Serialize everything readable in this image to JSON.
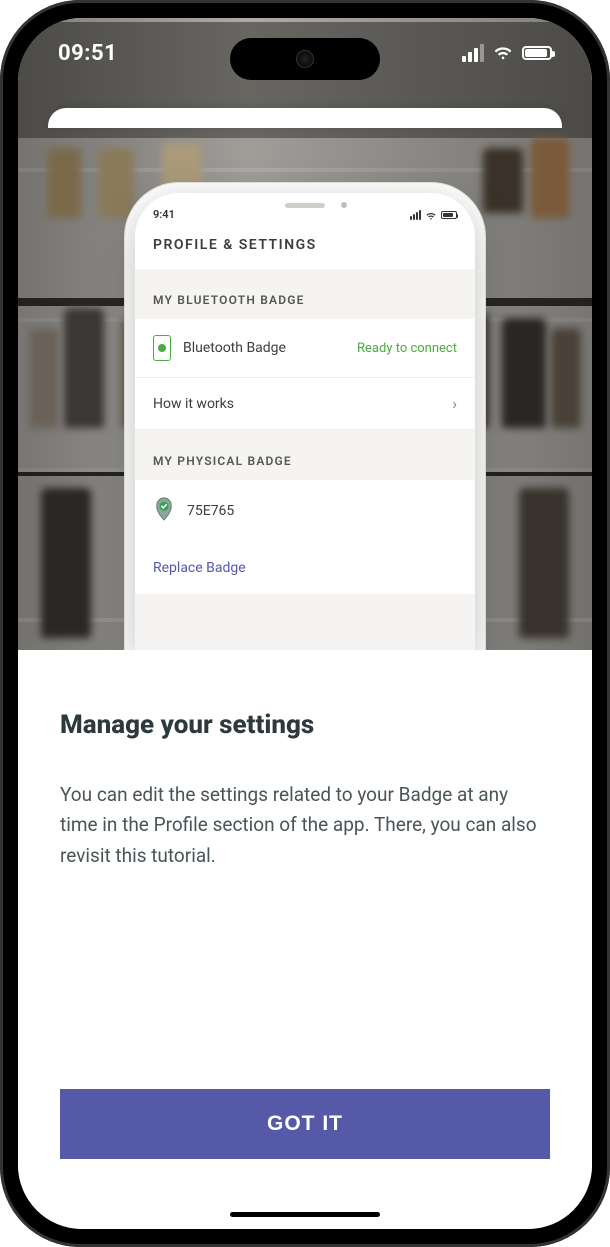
{
  "status": {
    "time": "09:51"
  },
  "inner": {
    "time": "9:41",
    "header": "PROFILE & SETTINGS",
    "bt_section": "MY BLUETOOTH BADGE",
    "bt_label": "Bluetooth Badge",
    "bt_status": "Ready to connect",
    "how_it_works": "How it works",
    "phys_section": "MY PHYSICAL BADGE",
    "phys_id": "75E765",
    "replace": "Replace Badge"
  },
  "sheet": {
    "title": "Manage your settings",
    "body": "You can edit the settings related to your Badge at any time in the Profile section of the app. There, you can also revisit this tutorial.",
    "cta": "GOT IT"
  }
}
